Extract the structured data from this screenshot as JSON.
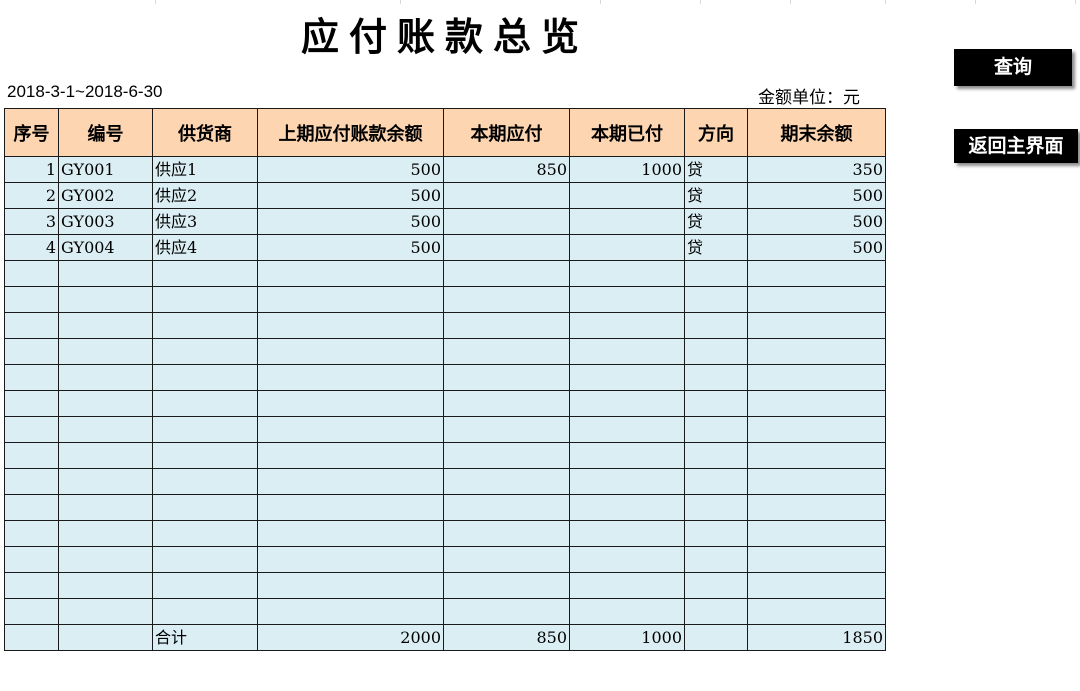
{
  "title": "应付账款总览",
  "period": "2018-3-1~2018-6-30",
  "unit_label": "金额单位：元",
  "buttons": {
    "query": "查询",
    "home": "返回主界面"
  },
  "table": {
    "headers": [
      "序号",
      "编号",
      "供货商",
      "上期应付账款余额",
      "本期应付",
      "本期已付",
      "方向",
      "期末余额"
    ],
    "rows": [
      [
        "1",
        "GY001",
        "供应1",
        "500",
        "850",
        "1000",
        "贷",
        "350"
      ],
      [
        "2",
        "GY002",
        "供应2",
        "500",
        "",
        "",
        "贷",
        "500"
      ],
      [
        "3",
        "GY003",
        "供应3",
        "500",
        "",
        "",
        "贷",
        "500"
      ],
      [
        "4",
        "GY004",
        "供应4",
        "500",
        "",
        "",
        "贷",
        "500"
      ],
      [
        "",
        "",
        "",
        "",
        "",
        "",
        "",
        ""
      ],
      [
        "",
        "",
        "",
        "",
        "",
        "",
        "",
        ""
      ],
      [
        "",
        "",
        "",
        "",
        "",
        "",
        "",
        ""
      ],
      [
        "",
        "",
        "",
        "",
        "",
        "",
        "",
        ""
      ],
      [
        "",
        "",
        "",
        "",
        "",
        "",
        "",
        ""
      ],
      [
        "",
        "",
        "",
        "",
        "",
        "",
        "",
        ""
      ],
      [
        "",
        "",
        "",
        "",
        "",
        "",
        "",
        ""
      ],
      [
        "",
        "",
        "",
        "",
        "",
        "",
        "",
        ""
      ],
      [
        "",
        "",
        "",
        "",
        "",
        "",
        "",
        ""
      ],
      [
        "",
        "",
        "",
        "",
        "",
        "",
        "",
        ""
      ],
      [
        "",
        "",
        "",
        "",
        "",
        "",
        "",
        ""
      ],
      [
        "",
        "",
        "",
        "",
        "",
        "",
        "",
        ""
      ],
      [
        "",
        "",
        "",
        "",
        "",
        "",
        "",
        ""
      ],
      [
        "",
        "",
        "",
        "",
        "",
        "",
        "",
        ""
      ],
      [
        "",
        "",
        "合计",
        "2000",
        "850",
        "1000",
        "",
        "1850"
      ]
    ]
  }
}
